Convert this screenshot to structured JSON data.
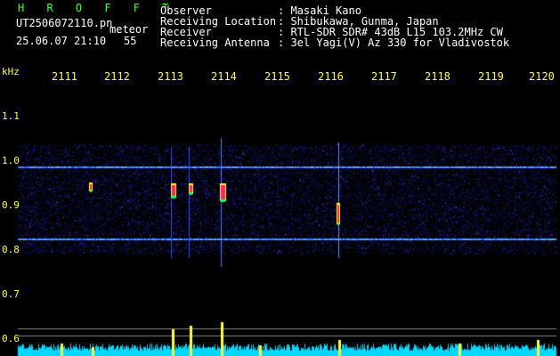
{
  "header": {
    "app_name": "H R O F F T",
    "filename": "UT2506072110.pn",
    "meteor_tag": "meteor",
    "datetime": "25.06.07 21:10",
    "count": "55",
    "fields": [
      {
        "label": "Observer",
        "value": ": Masaki Kano"
      },
      {
        "label": "Receiving Location",
        "value": ": Shibukawa, Gunma, Japan"
      },
      {
        "label": "Receiver",
        "value": ": RTL-SDR SDR# 43dB L15 103.2MHz CW"
      },
      {
        "label": "Receiving Antenna",
        "value": ": 3el Yagi(V) Az 330 for Vladivostok"
      }
    ]
  },
  "axes": {
    "unit": "kHz",
    "x_ticks": [
      "2111",
      "2112",
      "2113",
      "2114",
      "2115",
      "2116",
      "2117",
      "2118",
      "2119",
      "2120"
    ],
    "y_ticks": [
      "1.1",
      "1.0",
      "0.9",
      "0.8",
      "0.7",
      "0.6"
    ]
  },
  "colors": {
    "background": "#000000",
    "label_yellow": "#ffff40",
    "title_green": "#40ff40",
    "noise_blue": "#1a1aa0",
    "level_cyan": "#00e0ff"
  }
}
